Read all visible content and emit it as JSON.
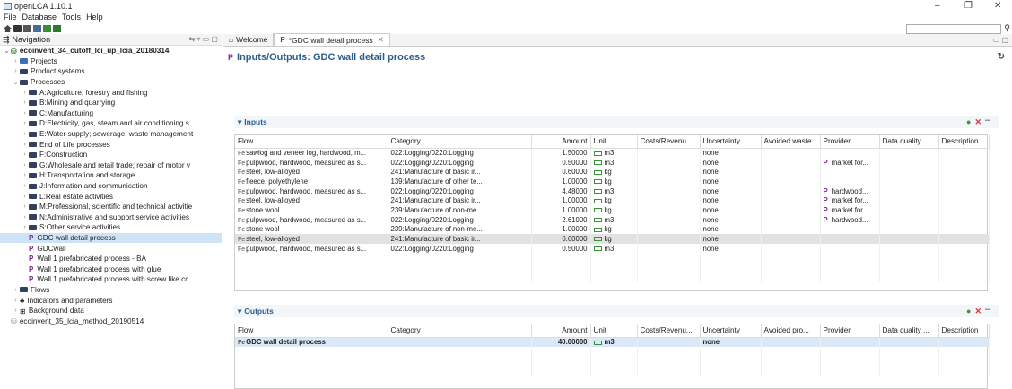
{
  "window": {
    "title": "openLCA 1.10.1",
    "minimize": "–",
    "maximize": "❐",
    "close": "✕"
  },
  "menu": [
    "File",
    "Database",
    "Tools",
    "Help"
  ],
  "navigation": {
    "title": "Navigation",
    "root": "ecoinvent_34_cutoff_lci_up_lcia_20180314",
    "items": [
      {
        "label": "Projects",
        "level": 1,
        "type": "folder-blue",
        "arrow": "›"
      },
      {
        "label": "Product systems",
        "level": 1,
        "type": "folder",
        "arrow": "›"
      },
      {
        "label": "Processes",
        "level": 1,
        "type": "folder",
        "arrow": "⌄"
      },
      {
        "label": "A:Agriculture, forestry and fishing",
        "level": 2,
        "type": "folder",
        "arrow": "›"
      },
      {
        "label": "B:Mining and quarrying",
        "level": 2,
        "type": "folder",
        "arrow": "›"
      },
      {
        "label": "C:Manufacturing",
        "level": 2,
        "type": "folder",
        "arrow": "›"
      },
      {
        "label": "D:Electricity, gas, steam and air conditioning s",
        "level": 2,
        "type": "folder",
        "arrow": "›"
      },
      {
        "label": "E:Water supply; sewerage, waste management",
        "level": 2,
        "type": "folder",
        "arrow": "›"
      },
      {
        "label": "End of Life processes",
        "level": 2,
        "type": "folder",
        "arrow": "›"
      },
      {
        "label": "F:Construction",
        "level": 2,
        "type": "folder",
        "arrow": "›"
      },
      {
        "label": "G:Wholesale and retail trade; repair of motor v",
        "level": 2,
        "type": "folder",
        "arrow": "›"
      },
      {
        "label": "H:Transportation and storage",
        "level": 2,
        "type": "folder",
        "arrow": "›"
      },
      {
        "label": "J:Information and communication",
        "level": 2,
        "type": "folder",
        "arrow": "›"
      },
      {
        "label": "L:Real estate activities",
        "level": 2,
        "type": "folder",
        "arrow": "›"
      },
      {
        "label": "M:Professional, scientific and technical activitie",
        "level": 2,
        "type": "folder",
        "arrow": "›"
      },
      {
        "label": "N:Administrative and support service activities",
        "level": 2,
        "type": "folder",
        "arrow": "›"
      },
      {
        "label": "S:Other service activities",
        "level": 2,
        "type": "folder",
        "arrow": "›"
      },
      {
        "label": "GDC wall detail process",
        "level": 2,
        "type": "process",
        "arrow": "",
        "selected": true
      },
      {
        "label": "GDCwall",
        "level": 2,
        "type": "process",
        "arrow": ""
      },
      {
        "label": "Wall 1 prefabricated process - BA",
        "level": 2,
        "type": "process",
        "arrow": ""
      },
      {
        "label": "Wall 1 prefabricated process with glue",
        "level": 2,
        "type": "process",
        "arrow": ""
      },
      {
        "label": "Wall 1 prefabricated process with screw like cc",
        "level": 2,
        "type": "process",
        "arrow": ""
      },
      {
        "label": "Flows",
        "level": 1,
        "type": "folder",
        "arrow": "›"
      },
      {
        "label": "Indicators and parameters",
        "level": 1,
        "type": "indicator",
        "arrow": "›"
      },
      {
        "label": "Background data",
        "level": 1,
        "type": "grid",
        "arrow": "›"
      },
      {
        "label": "ecoinvent_35_lcia_method_20190514",
        "level": 0,
        "type": "db",
        "arrow": ""
      }
    ]
  },
  "tabs": [
    {
      "label": "Welcome",
      "active": false
    },
    {
      "label": "*GDC wall detail process",
      "active": true
    }
  ],
  "page_title": "Inputs/Outputs: GDC wall detail process",
  "inputs": {
    "header": "Inputs",
    "columns": [
      "Flow",
      "Category",
      "Amount",
      "Unit",
      "Costs/Revenu...",
      "Uncertainty",
      "Avoided waste",
      "Provider",
      "Data quality ...",
      "Description"
    ],
    "rows": [
      [
        "sawlog and veneer log, hardwood, m...",
        "022:Logging/0220:Logging",
        "1.50000",
        "m3",
        "",
        "none",
        "",
        "",
        "",
        ""
      ],
      [
        "pulpwood, hardwood, measured as s...",
        "022:Logging/0220:Logging",
        "0.50000",
        "m3",
        "",
        "none",
        "",
        "market for...",
        "",
        ""
      ],
      [
        "steel, low-alloyed",
        "241:Manufacture of basic ir...",
        "0.60000",
        "kg",
        "",
        "none",
        "",
        "",
        "",
        ""
      ],
      [
        "fleece, polyethylene",
        "139:Manufacture of other te...",
        "1.00000",
        "kg",
        "",
        "none",
        "",
        "",
        "",
        ""
      ],
      [
        "pulpwood, hardwood, measured as s...",
        "022:Logging/0220:Logging",
        "4.48000",
        "m3",
        "",
        "none",
        "",
        "hardwood...",
        "",
        ""
      ],
      [
        "steel, low-alloyed",
        "241:Manufacture of basic ir...",
        "1.00000",
        "kg",
        "",
        "none",
        "",
        "market for...",
        "",
        ""
      ],
      [
        "stone wool",
        "239:Manufacture of non-me...",
        "1.00000",
        "kg",
        "",
        "none",
        "",
        "market for...",
        "",
        ""
      ],
      [
        "pulpwood, hardwood, measured as s...",
        "022:Logging/0220:Logging",
        "2.61000",
        "m3",
        "",
        "none",
        "",
        "hardwood...",
        "",
        ""
      ],
      [
        "stone wool",
        "239:Manufacture of non-me...",
        "1.00000",
        "kg",
        "",
        "none",
        "",
        "",
        "",
        ""
      ],
      [
        "steel, low-alloyed",
        "241:Manufacture of basic ir...",
        "0.60000",
        "kg",
        "",
        "none",
        "",
        "",
        "",
        ""
      ],
      [
        "pulpwood, hardwood, measured as s...",
        "022:Logging/0220:Logging",
        "0.50000",
        "m3",
        "",
        "none",
        "",
        "",
        "",
        ""
      ]
    ],
    "highlight_row": 9
  },
  "outputs": {
    "header": "Outputs",
    "columns": [
      "Flow",
      "Category",
      "Amount",
      "Unit",
      "Costs/Revenu...",
      "Uncertainty",
      "Avoided pro...",
      "Provider",
      "Data quality ...",
      "Description"
    ],
    "rows": [
      [
        "GDC wall detail process",
        "",
        "40.00000",
        "m3",
        "",
        "none",
        "",
        "",
        "",
        ""
      ]
    ]
  }
}
